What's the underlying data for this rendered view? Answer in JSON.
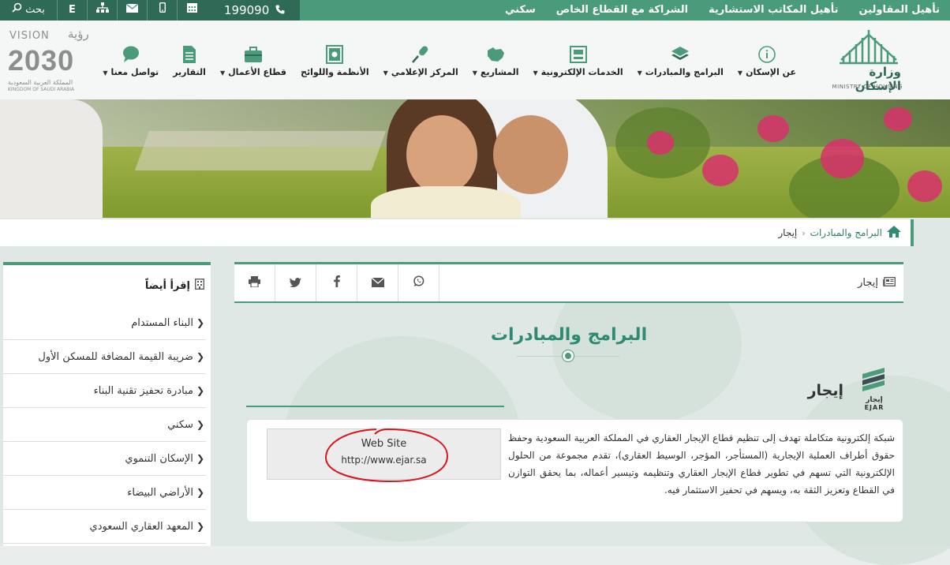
{
  "topbar": {
    "links": [
      "تأهيل المقاولين",
      "تأهيل المكاتب الاستشارية",
      "الشراكة مع القطاع الخاص",
      "سكني"
    ],
    "search_label": "بحث",
    "font_label": "E",
    "phone": "199090"
  },
  "header": {
    "ministry_name": "وزارة الإسكان",
    "ministry_en": "MINISTRY OF HOUSING",
    "vision_label": "VISION",
    "vision_arabic": "رؤية",
    "vision_year": "2030",
    "vision_kingdom_ar": "المملكة العربية السعودية",
    "vision_kingdom_en": "KINGDOM OF SAUDI ARABIA",
    "nav": [
      {
        "label": "عن الإسكان",
        "icon": "info-icon",
        "dropdown": true
      },
      {
        "label": "البرامج والمبادرات",
        "icon": "layers-icon",
        "dropdown": true
      },
      {
        "label": "الخدمات الإلكترونية",
        "icon": "eservices-icon",
        "dropdown": true
      },
      {
        "label": "المشاريع",
        "icon": "map-icon",
        "dropdown": true
      },
      {
        "label": "المركز الإعلامي",
        "icon": "microphone-icon",
        "dropdown": true
      },
      {
        "label": "الأنظمة واللوائح",
        "icon": "regulations-book-icon",
        "dropdown": false
      },
      {
        "label": "قطاع الأعمال",
        "icon": "briefcase-icon",
        "dropdown": true
      },
      {
        "label": "التقارير",
        "icon": "report-document-icon",
        "dropdown": false
      },
      {
        "label": "تواصل معنا",
        "icon": "chat-bubble-icon",
        "dropdown": true
      }
    ]
  },
  "breadcrumb": {
    "parent": "البرامج والمبادرات",
    "current": "إيجار"
  },
  "sidebar": {
    "title": "إقرأ أيضاً",
    "items": [
      "البناء المستدام",
      "ضريبة القيمة المضافة للمسكن الأول",
      "مبادرة تحفيز تقنية البناء",
      "سكني",
      "الإسكان التنموي",
      "الأراضي البيضاء",
      "المعهد العقاري السعودي"
    ]
  },
  "main": {
    "page_tag": "إيجار",
    "page_title": "البرامج والمبادرات",
    "section_title": "إيجار",
    "logo_text_ar": "إيجار",
    "logo_text_en": "EJAR",
    "description": "شبكة إلكترونية متكاملة تهدف إلى تنظيم قطاع الإيجار العقاري في المملكة العربية السعودية وحفظ حقوق أطراف العملية الإيجارية (المستأجر، المؤجر، الوسيط العقاري)، تقدم مجموعة من الحلول الإلكترونية التي تسهم في تطوير قطاع الإيجار العقاري وتنظيمه وتيسير أعماله، بما يحقق التوازن في القطاع وتعزيز الثقة به، ويسهم في تحفيز الاستثمار فيه.",
    "website_label": "Web Site",
    "website_url": "http://www.ejar.sa"
  },
  "colors": {
    "brand_green": "#4a9b79",
    "dark_green": "#2f6a57",
    "title_green": "#2f8a73",
    "annotation_red": "#d8141c"
  }
}
